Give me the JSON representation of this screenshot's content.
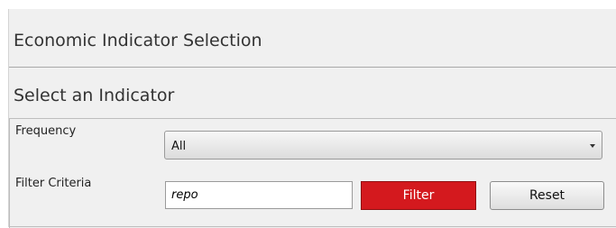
{
  "panel": {
    "title": "Economic Indicator Selection"
  },
  "section": {
    "title": "Select an Indicator"
  },
  "form": {
    "frequency": {
      "label": "Frequency",
      "selected": "All"
    },
    "filter_criteria": {
      "label": "Filter Criteria",
      "value": "repo",
      "placeholder": ""
    },
    "buttons": {
      "filter_label": "Filter",
      "reset_label": "Reset"
    }
  },
  "colors": {
    "filter_button": "#d4191e",
    "panel_background": "#f0f0f0"
  },
  "icons": {
    "dropdown": "chevron-down-icon"
  }
}
